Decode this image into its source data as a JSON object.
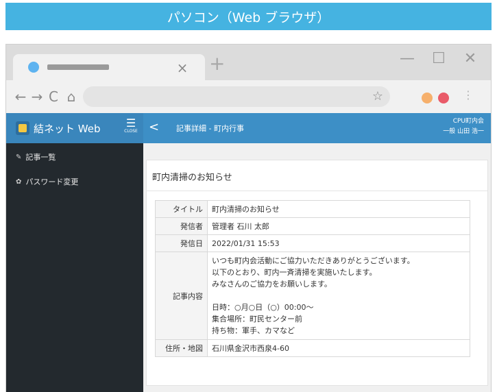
{
  "banner": {
    "text": "パソコン（Web ブラウザ）"
  },
  "browser": {
    "tab_close_glyph": "×",
    "new_tab_glyph": "+",
    "window_minimize": "—",
    "window_maximize": "☐",
    "window_close": "✕",
    "nav_back": "←",
    "nav_forward": "→",
    "nav_reload": "C",
    "nav_home": "⌂",
    "bookmark_star": "☆",
    "menu_dots": "⋮"
  },
  "app": {
    "brand_name": "結ネット Web",
    "close_label": "CLOSE",
    "back_glyph": "<",
    "page_title": "記事詳細 - 町内行事",
    "user_org": "CPU町内会",
    "user_name": "一般  山田 浩一"
  },
  "sidebar": {
    "items": [
      {
        "icon": "edit-icon",
        "glyph": "✎",
        "label": "記事一覧"
      },
      {
        "icon": "gear-icon",
        "glyph": "✿",
        "label": "パスワード変更"
      }
    ]
  },
  "article": {
    "heading": "町内清掃のお知らせ",
    "rows": {
      "title_label": "タイトル",
      "title_value": "町内清掃のお知らせ",
      "sender_label": "発信者",
      "sender_value": "管理者 石川 太郎",
      "date_label": "発信日",
      "date_value": "2022/01/31 15:53",
      "body_label": "記事内容",
      "body_lines": [
        "いつも町内会活動にご協力いただきありがとうございます。",
        "以下のとおり、町内一斉清掃を実施いたします。",
        "みなさんのご協力をお願いします。",
        "",
        "日時：○月○日（○）00:00～",
        "集合場所：町民センター前",
        "持ち物：軍手、カマなど"
      ],
      "address_label": "住所・地図",
      "address_value": "石川県金沢市西泉4-60"
    }
  },
  "colors": {
    "banner": "#45b3e1",
    "header": "#3d8fc6",
    "sidebar": "#23292e"
  }
}
